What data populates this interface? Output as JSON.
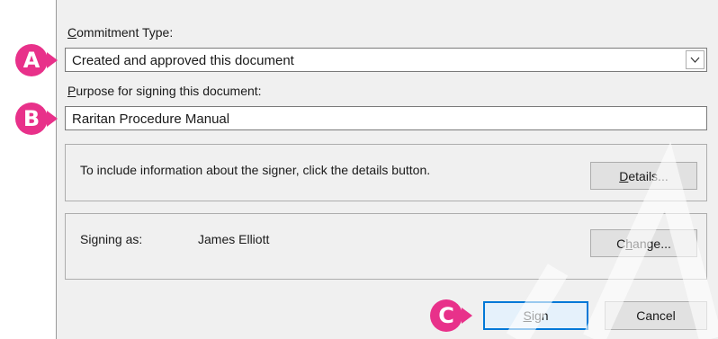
{
  "colors": {
    "dialog_bg": "#f0f0f0",
    "callout": "#e8318a",
    "default_button_border": "#0078d7"
  },
  "commitment": {
    "label": "Commitment Type:",
    "label_mnemonic": "C",
    "label_rest": "ommitment Type:",
    "value": "Created and approved this document",
    "dropdown_icon": "chevron-down-icon"
  },
  "purpose": {
    "label_mnemonic": "P",
    "label_rest": "urpose for signing this document:",
    "value": "Raritan Procedure Manual"
  },
  "details_group": {
    "text": "To include information about the signer, click the details button.",
    "button_mnemonic": "D",
    "button_rest": "etails..."
  },
  "signer_group": {
    "prefix": "Signing as:",
    "name": "James Elliott",
    "button_pre": "C",
    "button_mnemonic": "h",
    "button_rest": "ange..."
  },
  "actions": {
    "sign_mnemonic": "S",
    "sign_rest": "ign",
    "cancel": "Cancel"
  },
  "callouts": {
    "a": "A",
    "b": "B",
    "c": "C"
  }
}
